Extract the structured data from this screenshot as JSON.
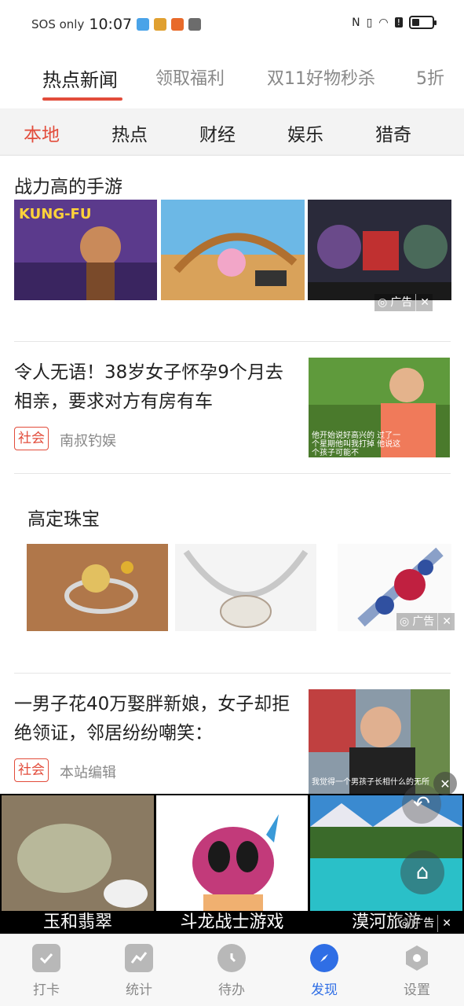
{
  "status_bar": {
    "carrier": "SOS only",
    "time": "10:07"
  },
  "top_tabs": [
    "热点新闻",
    "领取福利",
    "双11好物秒杀",
    "5折"
  ],
  "categories": [
    "本地",
    "热点",
    "财经",
    "娱乐",
    "猎奇"
  ],
  "feed": {
    "games_section": {
      "title": "战力高的手游",
      "ad_label": "广告"
    },
    "news1": {
      "title": "令人无语！38岁女子怀孕9个月去相亲，要求对方有房有车",
      "tag": "社会",
      "source": "南叔钓娱",
      "thumb_caption": "他开始说好高兴的 过了一个星期他叫我打掉 他说这个孩子可能不"
    },
    "jewelry_section": {
      "title": "高定珠宝",
      "ad_label": "广告"
    },
    "news2": {
      "title": "一男子花40万娶胖新娘，女子却拒绝领证，邻居纷纷嘲笑：",
      "tag": "社会",
      "source": "本站编辑",
      "thumb_caption": "我觉得一个男孩子长相什么的无所"
    }
  },
  "bottom_ads": {
    "items": [
      "玉和翡翠",
      "斗龙战士游戏",
      "漠河旅游"
    ],
    "ad_label": "广告"
  },
  "bottom_nav": {
    "items": [
      "打卡",
      "统计",
      "待办",
      "发现",
      "设置"
    ],
    "active": "发现"
  },
  "colors": {
    "accent": "#e24c3b",
    "nav_active": "#2f6ee5"
  }
}
